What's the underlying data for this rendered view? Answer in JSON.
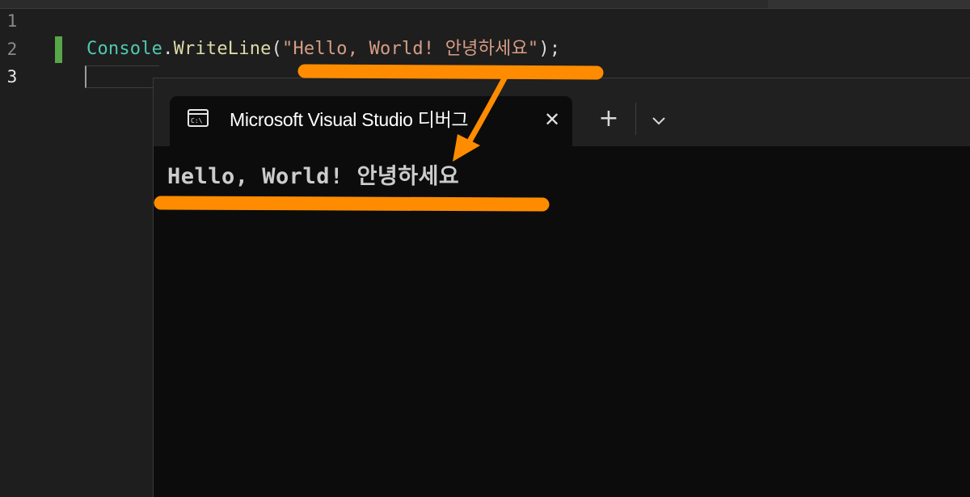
{
  "editor": {
    "line_numbers": [
      "1",
      "2",
      "3"
    ],
    "code": {
      "class_name": "Console",
      "dot": ".",
      "method": "WriteLine",
      "open_paren": "(",
      "string_literal": "\"Hello, World! 안녕하세요\"",
      "close": ");"
    },
    "change_bar_color": "#57a64a"
  },
  "terminal": {
    "tab_icon": "console-icon",
    "tab_title": "Microsoft Visual Studio 디버그",
    "close_icon": "close-icon",
    "new_tab_icon": "plus-icon",
    "dropdown_icon": "chevron-down-icon",
    "output": "Hello, World! 안녕하세요"
  },
  "annotation": {
    "color": "#ff8c00",
    "marks": [
      "underline",
      "arrow",
      "underline"
    ]
  }
}
